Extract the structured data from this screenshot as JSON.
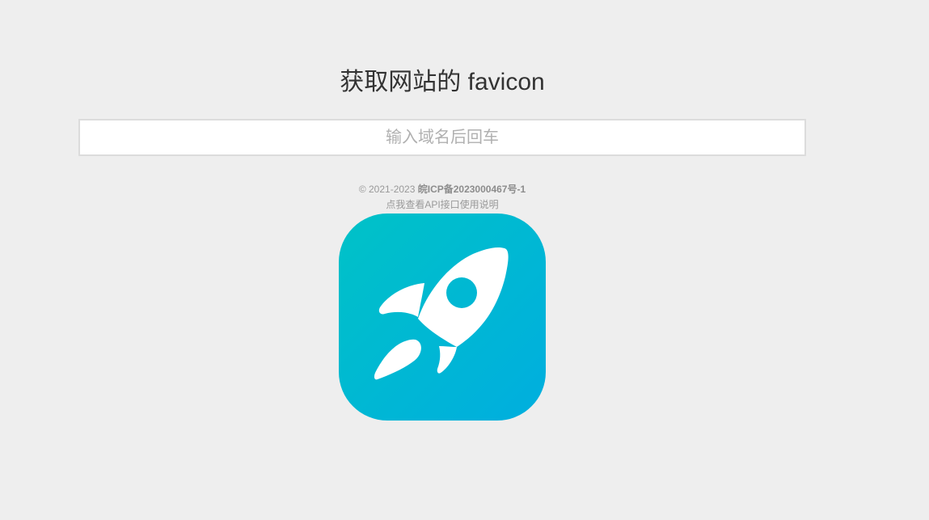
{
  "header": {
    "title": "获取网站的 favicon"
  },
  "search": {
    "placeholder": "输入域名后回车",
    "value": ""
  },
  "footer": {
    "copyright": "© 2021-2023 ",
    "icp": "皖ICP备2023000467号-1",
    "api_link": "点我查看API接口使用说明"
  },
  "icon": {
    "name": "rocket-icon",
    "gradient_start": "#00c2c7",
    "gradient_end": "#00aedf",
    "foreground": "#ffffff"
  }
}
